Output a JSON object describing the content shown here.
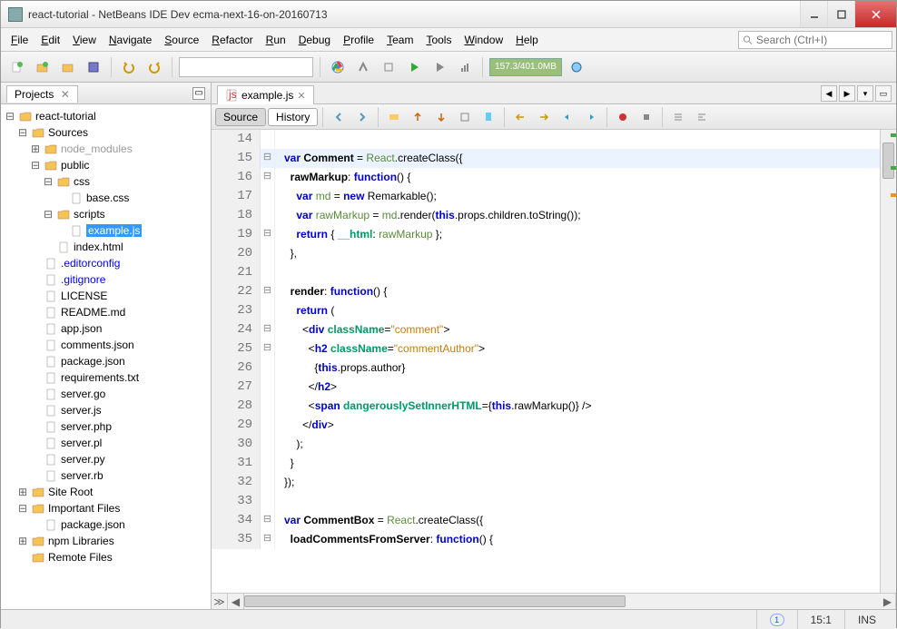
{
  "window": {
    "title": "react-tutorial - NetBeans IDE Dev ecma-next-16-on-20160713"
  },
  "menu": [
    "File",
    "Edit",
    "View",
    "Navigate",
    "Source",
    "Refactor",
    "Run",
    "Debug",
    "Profile",
    "Team",
    "Tools",
    "Window",
    "Help"
  ],
  "search": {
    "placeholder": "Search (Ctrl+I)"
  },
  "memory": "157.3/401.0MB",
  "projects": {
    "panel_label": "Projects",
    "root": "react-tutorial",
    "sources_label": "Sources",
    "node_modules": "node_modules",
    "public": "public",
    "css": "css",
    "base_css": "base.css",
    "scripts": "scripts",
    "example_js": "example.js",
    "index_html": "index.html",
    "editorconfig": ".editorconfig",
    "gitignore": ".gitignore",
    "license": "LICENSE",
    "readme": "README.md",
    "app_json": "app.json",
    "comments_json": "comments.json",
    "package_json": "package.json",
    "requirements_txt": "requirements.txt",
    "server_go": "server.go",
    "server_js": "server.js",
    "server_php": "server.php",
    "server_pl": "server.pl",
    "server_py": "server.py",
    "server_rb": "server.rb",
    "site_root": "Site Root",
    "important_files": "Important Files",
    "important_package_json": "package.json",
    "npm_libraries": "npm Libraries",
    "remote_files": "Remote Files"
  },
  "editor": {
    "tab_label": "example.js",
    "source_label": "Source",
    "history_label": "History",
    "lines": [
      {
        "n": 14,
        "fold": "",
        "html": ""
      },
      {
        "n": 15,
        "fold": "⊟",
        "hl": true,
        "html": "<span class='kw'>var</span> <span class='cls'>Comment</span> = <span class='var-use'>React</span>.<span class='fn'>createClass</span>({"
      },
      {
        "n": 16,
        "fold": "⊟",
        "html": "  <span class='method-def'>rawMarkup</span>: <span class='kw'>function</span>() {"
      },
      {
        "n": 17,
        "fold": "",
        "html": "    <span class='kw'>var</span> <span class='var-use'>md</span> = <span class='kw'>new</span> <span class='fn'>Remarkable</span>();"
      },
      {
        "n": 18,
        "fold": "",
        "html": "    <span class='kw'>var</span> <span class='var-use'>rawMarkup</span> = <span class='var-use'>md</span>.<span class='fn'>render</span>(<span class='kw'>this</span>.props.children.<span class='fn'>toString</span>());"
      },
      {
        "n": 19,
        "fold": "⊟",
        "html": "    <span class='kw'>return</span> { <span class='prop'>__html</span>: <span class='var-use'>rawMarkup</span> };"
      },
      {
        "n": 20,
        "fold": "",
        "html": "  },"
      },
      {
        "n": 21,
        "fold": "",
        "html": ""
      },
      {
        "n": 22,
        "fold": "⊟",
        "html": "  <span class='method-def'>render</span>: <span class='kw'>function</span>() {"
      },
      {
        "n": 23,
        "fold": "",
        "html": "    <span class='kw'>return</span> ("
      },
      {
        "n": 24,
        "fold": "⊟",
        "html": "      &lt;<span class='tag'>div</span> <span class='attr'>className</span>=<span class='str'>\"comment\"</span>&gt;"
      },
      {
        "n": 25,
        "fold": "⊟",
        "html": "        &lt;<span class='tag'>h2</span> <span class='attr'>className</span>=<span class='str'>\"commentAuthor\"</span>&gt;"
      },
      {
        "n": 26,
        "fold": "",
        "html": "          {<span class='kw'>this</span>.props.author}"
      },
      {
        "n": 27,
        "fold": "",
        "html": "        &lt;/<span class='tag'>h2</span>&gt;"
      },
      {
        "n": 28,
        "fold": "",
        "html": "        &lt;<span class='tag'>span</span> <span class='attr'>dangerouslySetInnerHTML</span>={<span class='kw'>this</span>.<span class='fn'>rawMarkup</span>()} /&gt;"
      },
      {
        "n": 29,
        "fold": "",
        "html": "      &lt;/<span class='tag'>div</span>&gt;"
      },
      {
        "n": 30,
        "fold": "",
        "html": "    );"
      },
      {
        "n": 31,
        "fold": "",
        "html": "  }"
      },
      {
        "n": 32,
        "fold": "",
        "html": "});"
      },
      {
        "n": 33,
        "fold": "",
        "html": ""
      },
      {
        "n": 34,
        "fold": "⊟",
        "html": "<span class='kw'>var</span> <span class='cls'>CommentBox</span> = <span class='var-use'>React</span>.<span class='fn'>createClass</span>({"
      },
      {
        "n": 35,
        "fold": "⊟",
        "html": "  <span class='method-def'>loadCommentsFromServer</span>: <span class='kw'>function</span>() {"
      }
    ]
  },
  "status": {
    "notif": "1",
    "pos": "15:1",
    "ins": "INS"
  }
}
